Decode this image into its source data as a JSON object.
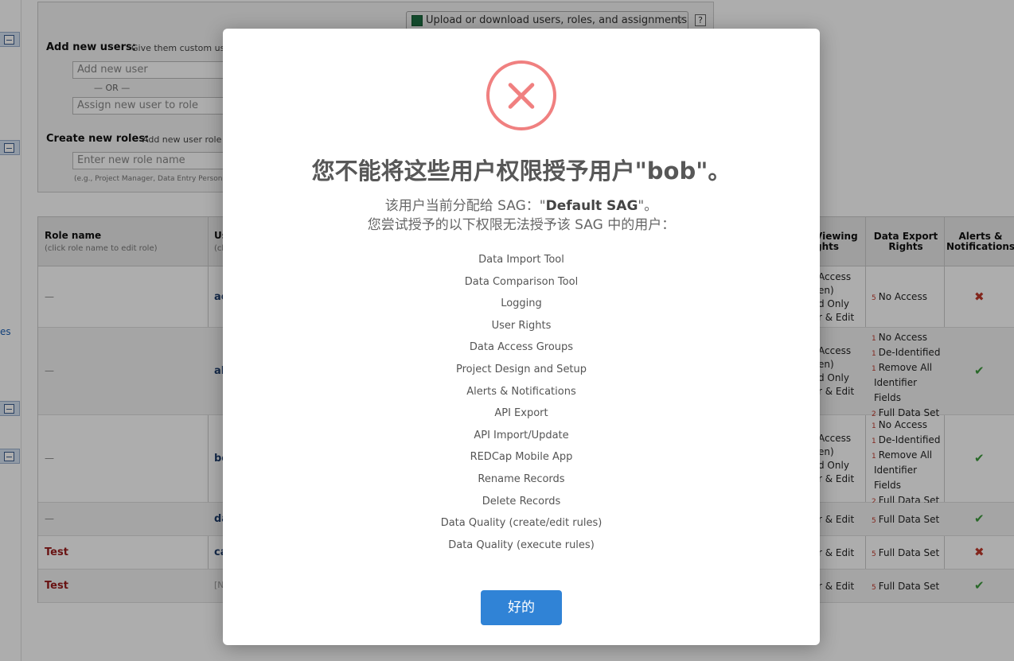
{
  "background": {
    "rail_text": "es",
    "upload_button": "Upload or download users, roles, and assignments",
    "help_label": "?",
    "add_users": {
      "label": "Add new users:",
      "desc": "Give them custom us",
      "input_placeholder": "Add new user",
      "or_text": "— OR —",
      "assign_placeholder": "Assign new user to role"
    },
    "create_roles": {
      "label": "Create new roles:",
      "desc": "Add new user role",
      "input_placeholder": "Enter new role name",
      "hint": "(e.g., Project Manager, Data Entry Person"
    },
    "table": {
      "headers": {
        "role_name": "Role name",
        "role_name_sub": "(click role name to edit role)",
        "user": "Us",
        "user_sub": "(cli",
        "viewing": "Viewing",
        "viewing_2": "ghts",
        "export": "Data Export",
        "export_2": "Rights",
        "alerts": "Alerts &",
        "alerts_2": "Notifications"
      },
      "rows": [
        {
          "role": "—",
          "user": "ac",
          "viewing": [
            "Access",
            "en)",
            "d Only",
            "r & Edit"
          ],
          "export": [
            {
              "n": "5",
              "t": "No Access"
            }
          ],
          "alerts": "✖"
        },
        {
          "role": "—",
          "user": "al",
          "viewing": [
            "Access",
            "en)",
            "d Only",
            "r & Edit"
          ],
          "export": [
            {
              "n": "1",
              "t": "No Access"
            },
            {
              "n": "1",
              "t": "De-Identified"
            },
            {
              "n": "1",
              "t": "Remove All"
            },
            {
              "n": "",
              "t": "Identifier"
            },
            {
              "n": "",
              "t": "Fields"
            },
            {
              "n": "2",
              "t": "Full Data Set"
            }
          ],
          "alerts": "✔"
        },
        {
          "role": "—",
          "user": "bo",
          "viewing": [
            "Access",
            "en)",
            "d Only",
            "r & Edit"
          ],
          "export": [
            {
              "n": "1",
              "t": "No Access"
            },
            {
              "n": "1",
              "t": "De-Identified"
            },
            {
              "n": "1",
              "t": "Remove All"
            },
            {
              "n": "",
              "t": "Identifier"
            },
            {
              "n": "",
              "t": "Fields"
            },
            {
              "n": "2",
              "t": "Full Data Set"
            }
          ],
          "alerts": "✔"
        },
        {
          "role": "—",
          "user": "da",
          "viewing": [
            "r & Edit"
          ],
          "export": [
            {
              "n": "5",
              "t": "Full Data Set"
            }
          ],
          "alerts": "✔"
        },
        {
          "role": "Test",
          "user": "ca",
          "viewing": [
            "r & Edit"
          ],
          "export": [
            {
              "n": "5",
              "t": "Full Data Set"
            }
          ],
          "alerts": "✖"
        },
        {
          "role": "Test",
          "user": "[N",
          "viewing": [
            "r & Edit"
          ],
          "export": [
            {
              "n": "5",
              "t": "Full Data Set"
            }
          ],
          "alerts": "✔"
        }
      ]
    }
  },
  "modal": {
    "title": "您不能将这些用户权限授予用户\"bob\"。",
    "sub1_prefix": "该用户当前分配给 SAG：\"",
    "sag_name": "Default SAG",
    "sub1_suffix": "\"。",
    "sub2": "您尝试授予的以下权限无法授予该 SAG 中的用户：",
    "permissions": [
      "Data Import Tool",
      "Data Comparison Tool",
      "Logging",
      "User Rights",
      "Data Access Groups",
      "Project Design and Setup",
      "Alerts & Notifications",
      "API Export",
      "API Import/Update",
      "REDCap Mobile App",
      "Rename Records",
      "Delete Records",
      "Data Quality (create/edit rules)",
      "Data Quality (execute rules)"
    ],
    "ok_button": "好的"
  },
  "colors": {
    "error_icon": "#f08080",
    "ok_button": "#3083d6",
    "overlay": "rgba(0,0,0,0.32)"
  }
}
